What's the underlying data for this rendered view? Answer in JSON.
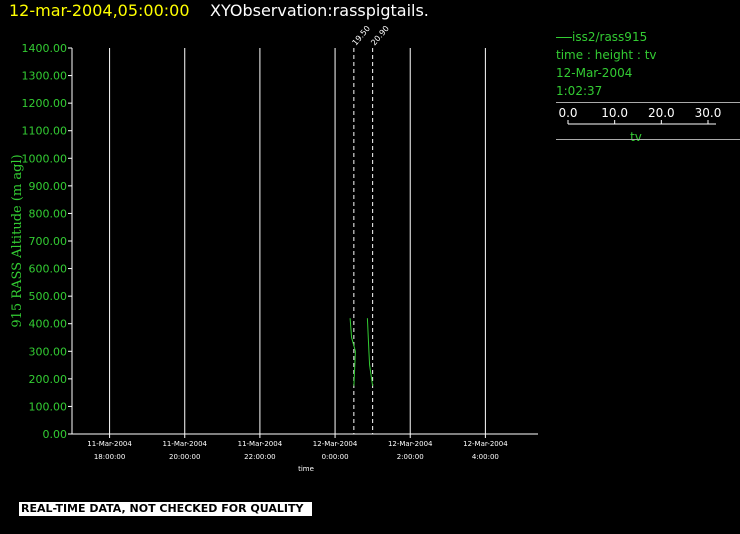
{
  "header": {
    "datetime": "12-mar-2004,05:00:00",
    "title": "XYObservation:rasspigtails."
  },
  "legend": {
    "station": "iss2/rass915",
    "fields": "time : height : tv",
    "date": "12-Mar-2004",
    "time": "1:02:37",
    "scale_ticks": [
      "0.0",
      "10.0",
      "20.0",
      "30.0"
    ],
    "scale_label": "tv"
  },
  "footer": {
    "notice": "REAL-TIME DATA, NOT CHECKED FOR QUALITY"
  },
  "colors": {
    "background": "#000000",
    "axis": "#ffffff",
    "gridline": "#ffffff",
    "tick_label": "#33cc33",
    "data": "#33cc33",
    "title_date": "#ffff00",
    "title_text": "#ffffff"
  },
  "chart_data": {
    "type": "line",
    "xlabel": "time",
    "ylabel": "915 RASS Altitude (m agl)",
    "ylim": [
      0,
      1400
    ],
    "y_ticks": [
      "0.00",
      "100.00",
      "200.00",
      "300.00",
      "400.00",
      "500.00",
      "600.00",
      "700.00",
      "800.00",
      "900.00",
      "1000.00",
      "1100.00",
      "1200.00",
      "1300.00",
      "1400.00"
    ],
    "x_ticks": [
      {
        "date": "11-Mar-2004",
        "time": "18:00:00",
        "hours": 18
      },
      {
        "date": "11-Mar-2004",
        "time": "20:00:00",
        "hours": 20
      },
      {
        "date": "11-Mar-2004",
        "time": "22:00:00",
        "hours": 22
      },
      {
        "date": "12-Mar-2004",
        "time": "0:00:00",
        "hours": 24
      },
      {
        "date": "12-Mar-2004",
        "time": "2:00:00",
        "hours": 26
      },
      {
        "date": "12-Mar-2004",
        "time": "4:00:00",
        "hours": 28
      }
    ],
    "xlim_hours": [
      17.0,
      29.4
    ],
    "grid": true,
    "reference_lines": [
      {
        "label": "19.50",
        "hours": 24.5
      },
      {
        "label": "20.90",
        "hours": 25.0
      }
    ],
    "series": [
      {
        "profile_hours": 24.5,
        "tv_scale": 0.02,
        "points": [
          {
            "tv": 19.5,
            "height": 175
          },
          {
            "tv": 19.7,
            "height": 300
          },
          {
            "tv": 19.2,
            "height": 350
          },
          {
            "tv": 19.0,
            "height": 420
          }
        ]
      },
      {
        "profile_hours": 25.0,
        "tv_scale": 0.02,
        "points": [
          {
            "tv": 20.9,
            "height": 175
          },
          {
            "tv": 20.5,
            "height": 250
          },
          {
            "tv": 20.4,
            "height": 300
          },
          {
            "tv": 20.2,
            "height": 420
          }
        ]
      }
    ]
  }
}
